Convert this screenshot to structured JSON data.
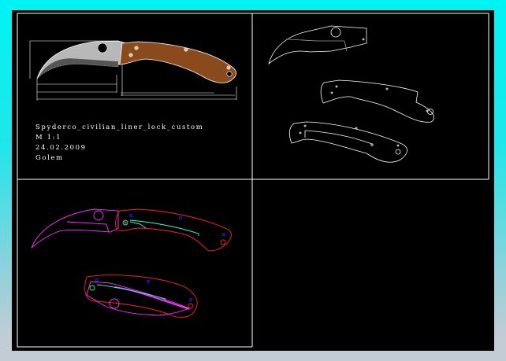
{
  "drawing": {
    "title": "Spyderco_civilian_liner_lock_custom",
    "scale": "M 1:1",
    "date": "24.02.2009",
    "author": "Golem"
  },
  "colors": {
    "background": "#000000",
    "frame": "#ffffff",
    "blade_outline": "#ff33ff",
    "handle_outline": "#ff2020",
    "liner": "#33ffdd",
    "pins": "#2020ff",
    "pivot": "#33ff33",
    "handle_fill": "#8b4a1c",
    "blade_fill": "#b8b8b8"
  }
}
